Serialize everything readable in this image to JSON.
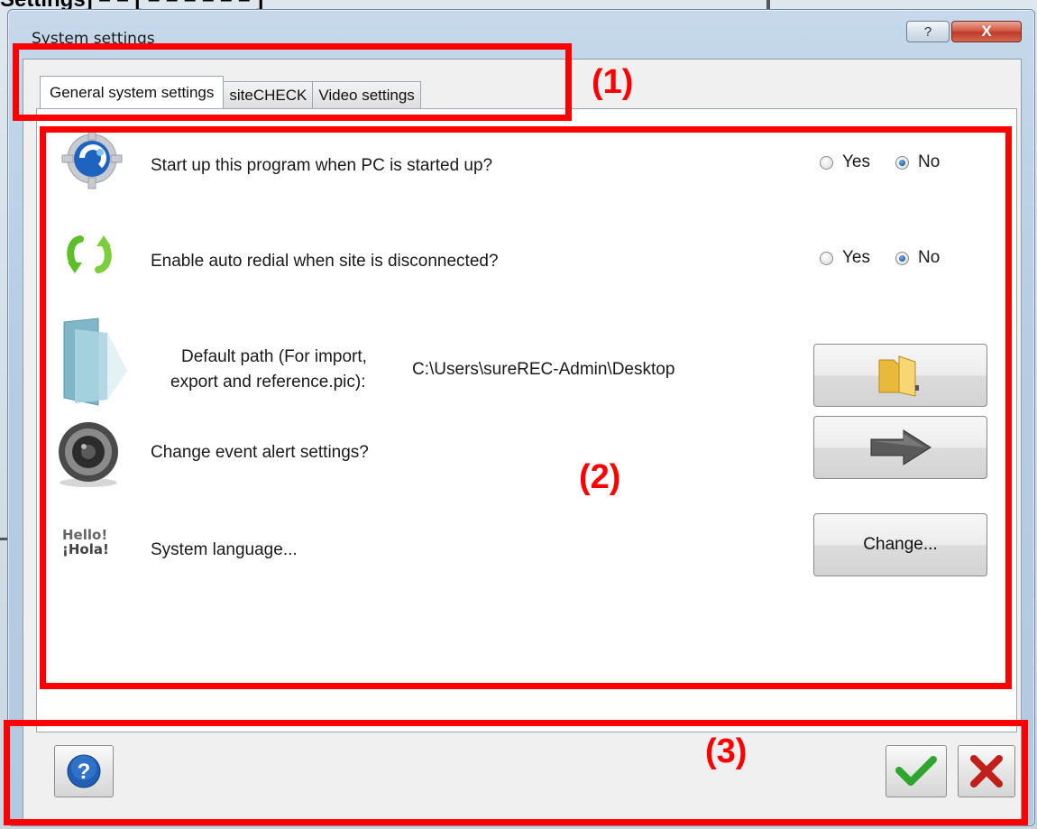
{
  "page_header": "Settings]  – – [ – – – – – – ]",
  "window": {
    "title": "System settings",
    "help_glyph": "?",
    "close_glyph": "X"
  },
  "tabs": [
    {
      "label": "General system settings",
      "active": true
    },
    {
      "label": "siteCHECK",
      "active": false
    },
    {
      "label": "Video settings",
      "active": false
    }
  ],
  "settings": {
    "startup": {
      "icon": "gear-globe-icon",
      "label": "Start up this program when PC is started up?",
      "options": [
        "Yes",
        "No"
      ],
      "selected": "No"
    },
    "redial": {
      "icon": "redial-arrows-icon",
      "label": "Enable auto redial when site is disconnected?",
      "options": [
        "Yes",
        "No"
      ],
      "selected": "No"
    },
    "default_path": {
      "icon": "folder-glass-icon",
      "label_line1": "Default path (For import,",
      "label_line2": "export and reference.pic):",
      "value": "C:\\Users\\sureREC-Admin\\Desktop",
      "button_icon": "folder-icon"
    },
    "event_alert": {
      "icon": "speaker-icon",
      "label": "Change event alert settings?",
      "button_icon": "arrow-right-icon"
    },
    "language": {
      "icon": "hello-hola-icon",
      "icon_text_1": "Hello!",
      "icon_text_2": "¡Hola!",
      "label": "System language...",
      "button_label": "Change..."
    }
  },
  "footer": {
    "help_icon": "help-circle-icon",
    "ok_icon": "checkmark-icon",
    "cancel_icon": "cross-icon"
  },
  "annotations": [
    "(1)",
    "(2)",
    "(3)"
  ],
  "colors": {
    "annotation": "#ff0000",
    "ok_green": "#2ea52e",
    "cancel_red": "#c0201a",
    "help_blue": "#1f5fb5"
  }
}
